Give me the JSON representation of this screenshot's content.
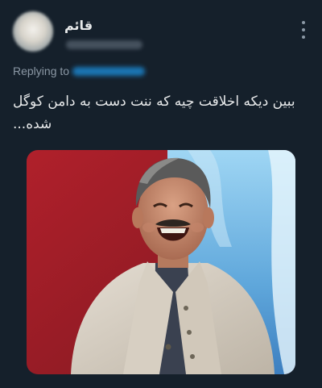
{
  "author": {
    "name": "قائم"
  },
  "reply": {
    "prefix": "Replying to"
  },
  "tweet": {
    "text": "ببین دیکه اخلاقت چیه که ننت دست به دامن کوگل شده..."
  },
  "icons": {
    "more": "more-vertical-icon"
  },
  "colors": {
    "background": "#15202b",
    "text": "#e7e9ea",
    "secondary": "#8b98a5",
    "accent": "#1d9bf0"
  }
}
